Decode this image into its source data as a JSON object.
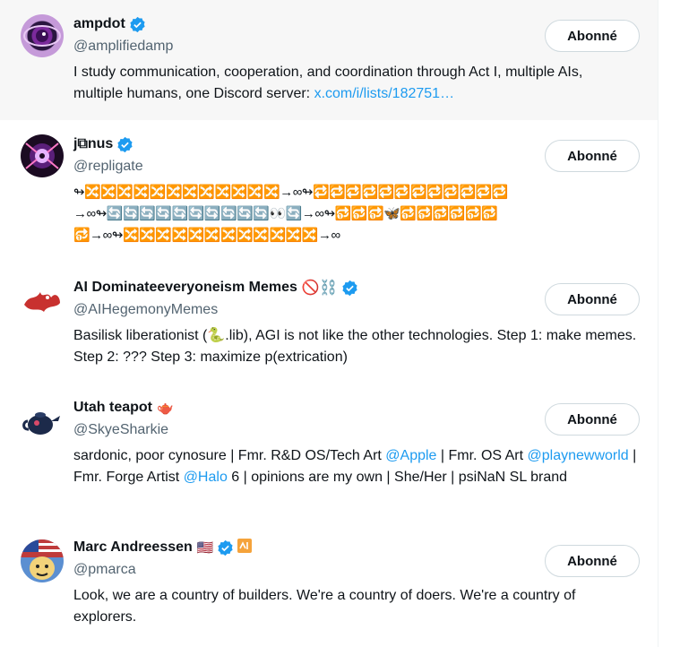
{
  "follow_label": "Abonné",
  "accounts": [
    {
      "name": "ampdot",
      "handle": "@amplifiedamp",
      "bio_text": "I study communication, cooperation, and coordination through Act I, multiple AIs, multiple humans, one Discord server: ",
      "bio_link": "x.com/i/lists/182751…"
    },
    {
      "name": "j⧉nus",
      "handle": "@repligate",
      "bio_line1": "↬🔀🔀🔀🔀🔀🔀🔀🔀🔀🔀🔀🔀→∞↬🔁🔁🔁🔁🔁🔁🔁🔁🔁🔁🔁🔁",
      "bio_line2": "→∞↬🔄🔄🔄🔄🔄🔄🔄🔄🔄🔄👀🔄→∞↬🔂🔂🔂🦋🔂🔂🔂🔂🔂🔂",
      "bio_line3": "🔂→∞↬🔀🔀🔀🔀🔀🔀🔀🔀🔀🔀🔀🔀→∞"
    },
    {
      "name": "AI Dominateeveryoneism Memes",
      "name_emoji": "🚫⛓️",
      "handle": "@AIHegemonyMemes",
      "bio_text": "Basilisk liberationist (🐍.lib), AGI is not like the other technologies. Step 1: make memes. Step 2: ??? Step 3: maximize p(extrication)"
    },
    {
      "name": "Utah teapot",
      "name_emoji": "🫖",
      "handle": "@SkyeSharkie",
      "bio_part1": "sardonic, poor cynosure | Fmr. R&D OS/Tech Art ",
      "mention1": "@Apple",
      "bio_part2": " | Fmr. OS Art ",
      "mention2": "@playnewworld",
      "bio_part3": " | Fmr. Forge Artist ",
      "mention3": "@Halo",
      "bio_part4": " 6 | opinions are my own | She/Her | psiNaN SL brand"
    },
    {
      "name": "Marc Andreessen",
      "name_emoji": "🇺🇸",
      "handle": "@pmarca",
      "bio_text": "Look, we are a country of builders. We're a country of doers. We're a country of explorers."
    }
  ],
  "colors": {
    "link": "#1d9bf0",
    "verified": "#1d9bf0",
    "muted": "#536471",
    "hover_bg": "#f7f7f7"
  },
  "icons": {
    "verified": "verified-badge-icon",
    "org_badge": "affiliate-badge-icon"
  }
}
